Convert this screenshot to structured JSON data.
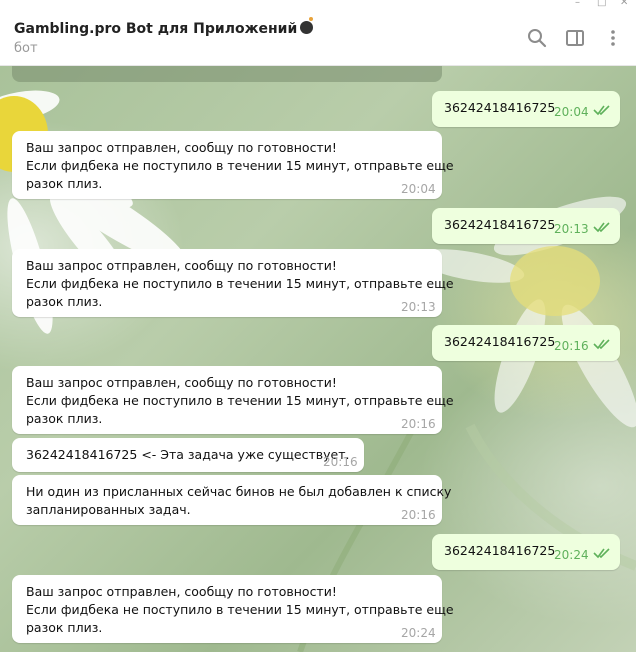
{
  "header": {
    "title": "Gambling.pro Bot для Приложений",
    "subtitle": "бот"
  },
  "colors": {
    "incoming_bubble": "#ffffff",
    "outgoing_bubble": "#eeffde",
    "read_checks": "#5fb15b",
    "time_incoming": "#a6a6a6"
  },
  "icons": [
    "search-icon",
    "sidebar-toggle-icon",
    "more-vertical-icon",
    "bomb-emoji-icon",
    "double-check-icon"
  ],
  "messages": [
    {
      "direction": "out",
      "text": "36242418416725",
      "time": "20:04",
      "read": true
    },
    {
      "direction": "in",
      "text": "Ваш запрос отправлен, сообщу по готовности!\nЕсли фидбека не поступило в течении 15 минут, отправьте еще\nразок плиз.",
      "time": "20:04"
    },
    {
      "direction": "out",
      "text": "36242418416725",
      "time": "20:13",
      "read": true
    },
    {
      "direction": "in",
      "text": "Ваш запрос отправлен, сообщу по готовности!\nЕсли фидбека не поступило в течении 15 минут, отправьте еще\nразок плиз.",
      "time": "20:13"
    },
    {
      "direction": "out",
      "text": "36242418416725",
      "time": "20:16",
      "read": true
    },
    {
      "direction": "in",
      "text": "Ваш запрос отправлен, сообщу по готовности!\nЕсли фидбека не поступило в течении 15 минут, отправьте еще\nразок плиз.",
      "time": "20:16"
    },
    {
      "direction": "in",
      "text": "36242418416725 <- Эта задача уже существует.",
      "time": "20:16"
    },
    {
      "direction": "in",
      "text": "Ни один из присланных сейчас бинов не был добавлен к списку\nзапланированных задач.",
      "time": "20:16"
    },
    {
      "direction": "out",
      "text": "36242418416725",
      "time": "20:24",
      "read": true
    },
    {
      "direction": "in",
      "text": "Ваш запрос отправлен, сообщу по готовности!\nЕсли фидбека не поступило в течении 15 минут, отправьте еще\nразок плиз.",
      "time": "20:24"
    }
  ]
}
